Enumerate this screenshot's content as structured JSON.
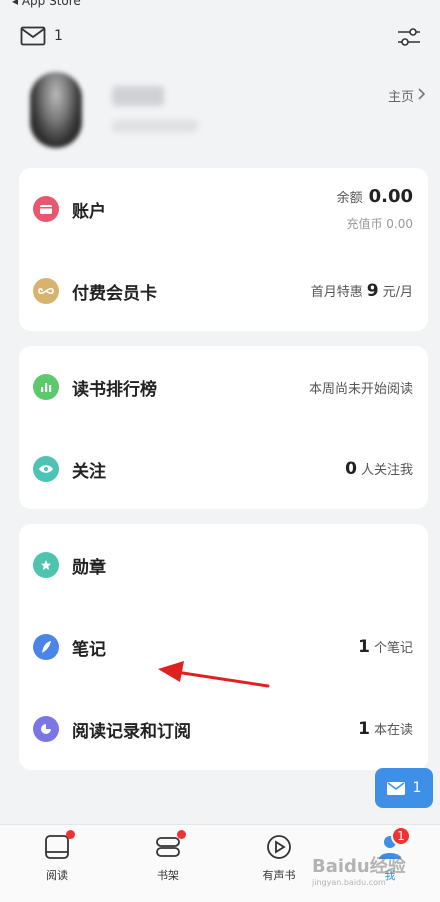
{
  "status": {
    "back_app": "◂ App Store"
  },
  "top": {
    "mail_count": "1"
  },
  "profile": {
    "home_label": "主页"
  },
  "account_card": {
    "account": {
      "label": "账户",
      "balance_label": "余额",
      "balance_value": "0.00",
      "recharge_text": "充值币 0.00"
    },
    "vip": {
      "label": "付费会员卡",
      "promo_prefix": "首月特惠",
      "promo_value": "9",
      "promo_suffix": "元/月"
    }
  },
  "social_card": {
    "ranking": {
      "label": "读书排行榜",
      "status": "本周尚未开始阅读"
    },
    "follow": {
      "label": "关注",
      "count": "0",
      "suffix": "人关注我"
    }
  },
  "library_card": {
    "medal": {
      "label": "勋章"
    },
    "notes": {
      "label": "笔记",
      "count": "1",
      "suffix": "个笔记"
    },
    "history": {
      "label": "阅读记录和订阅",
      "count": "1",
      "suffix": "本在读"
    }
  },
  "float_mail": {
    "count": "1"
  },
  "tabbar": {
    "tabs": [
      {
        "label": "阅读"
      },
      {
        "label": "书架"
      },
      {
        "label": "有声书"
      },
      {
        "label": "我"
      }
    ],
    "me_badge": "1"
  },
  "watermark": {
    "brand": "Baidu经验",
    "url": "jingyan.baidu.com"
  },
  "colors": {
    "accent_blue": "#3d8fe8",
    "account_icon": "#e8566f",
    "vip_icon": "#d8b36d",
    "ranking_icon": "#5bc96c",
    "follow_icon": "#4fc1b5",
    "medal_icon": "#4ec3ad",
    "notes_icon": "#4a86e8",
    "history_icon": "#7b76e6",
    "badge_red": "#e33333",
    "arrow_red": "#e02020"
  }
}
